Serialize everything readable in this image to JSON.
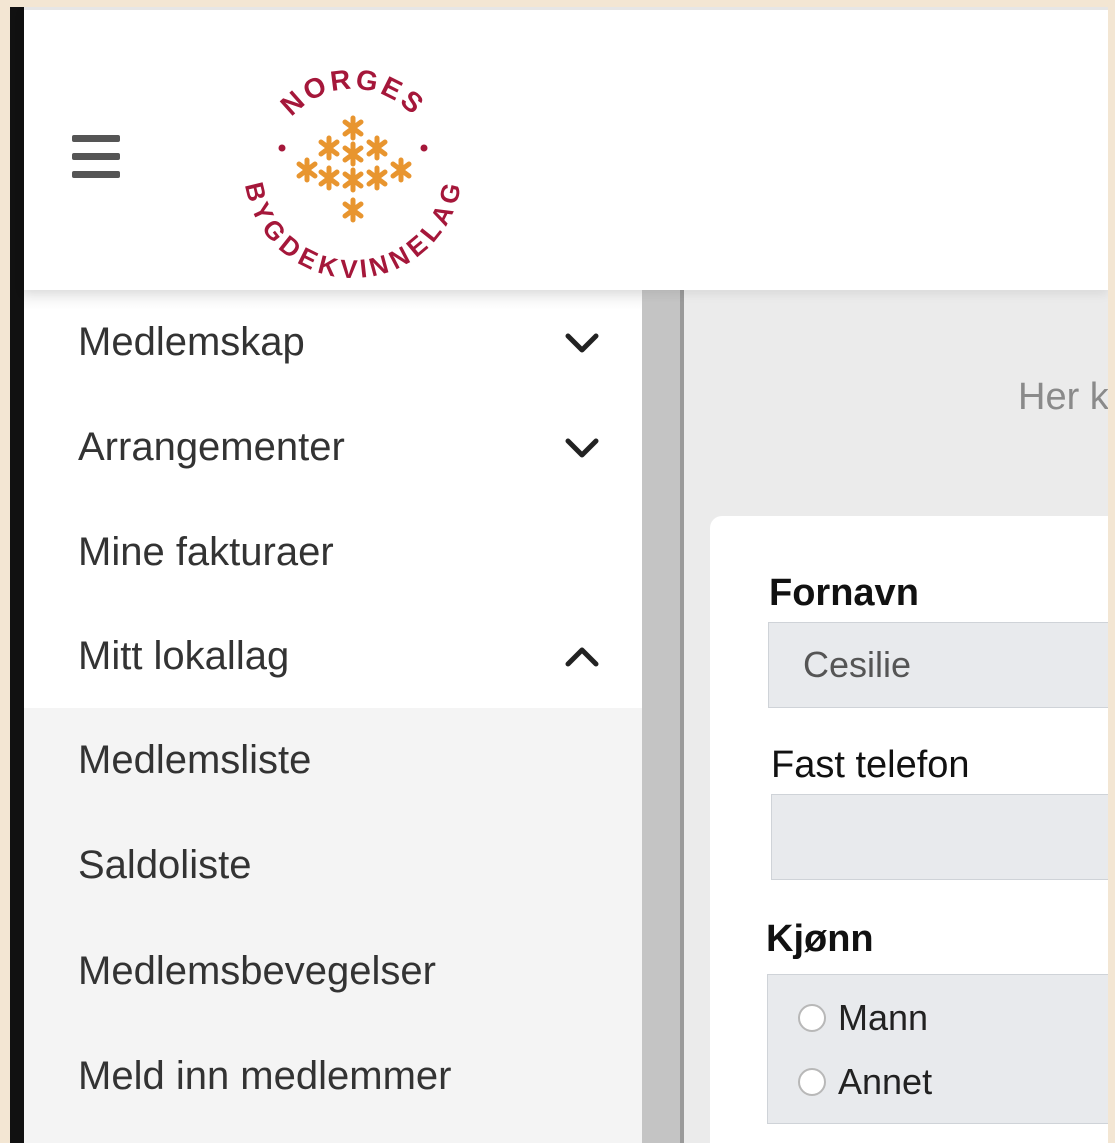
{
  "logo": {
    "top_text": "NORGES",
    "bottom_text": "BYGDEKVINNELAG"
  },
  "sidebar": {
    "items": [
      {
        "label": "Medlemskap",
        "chevron": "chevron-down"
      },
      {
        "label": "Arrangementer",
        "chevron": "chevron-down"
      },
      {
        "label": "Mine fakturaer"
      },
      {
        "label": "Mitt lokallag",
        "chevron": "chevron-up"
      }
    ],
    "submenu": [
      {
        "label": "Medlemsliste"
      },
      {
        "label": "Saldoliste"
      },
      {
        "label": "Medlemsbevegelser"
      },
      {
        "label": "Meld inn medlemmer"
      }
    ]
  },
  "main": {
    "intro_text": "Her k",
    "form": {
      "first_name_label": "Fornavn",
      "first_name_value": "Cesilie",
      "phone_label": "Fast telefon",
      "phone_value": "",
      "gender_label": "Kjønn",
      "gender_options": [
        "Mann",
        "Annet"
      ]
    }
  },
  "colors": {
    "logo_red": "#a5173a",
    "logo_orange": "#e8952f"
  }
}
